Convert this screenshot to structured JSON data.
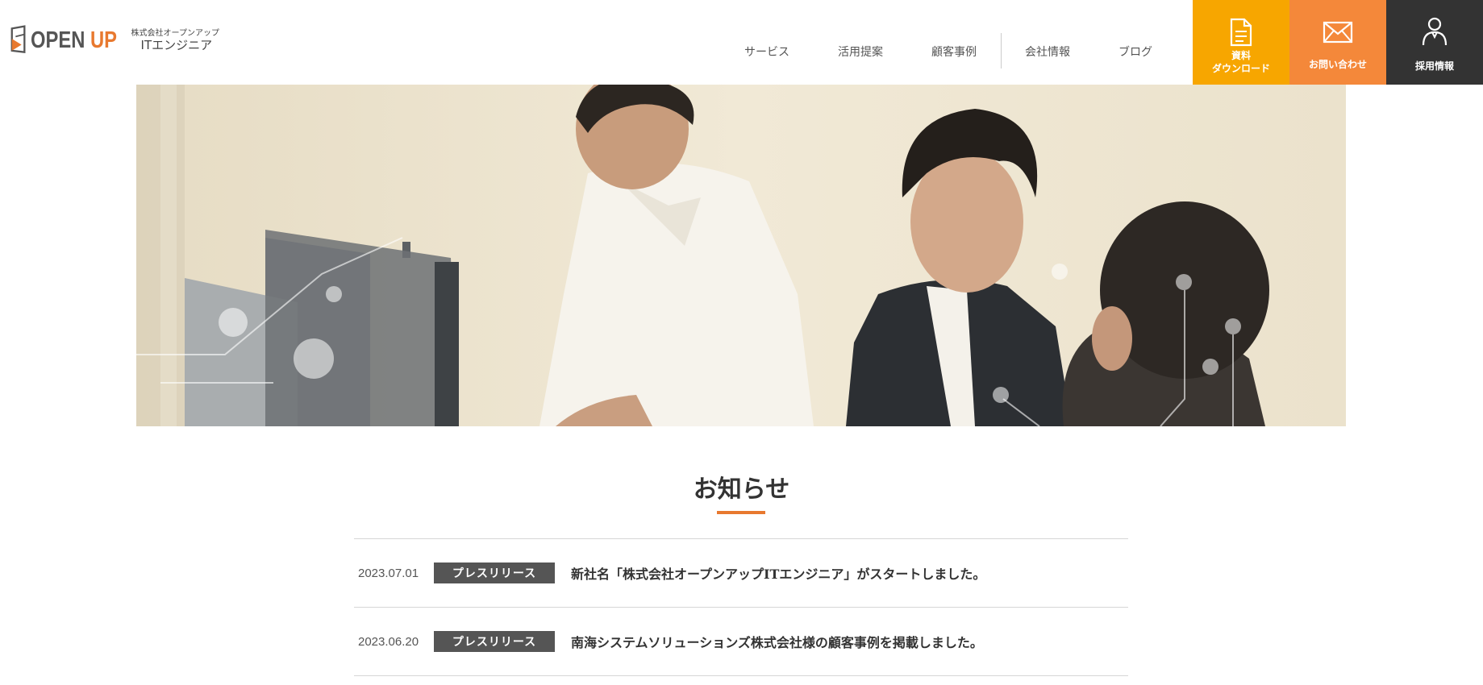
{
  "brand": {
    "logo_left": "OPEN ",
    "logo_right": "UP",
    "company_small": "株式会社オープンアップ",
    "company_large": "ITエンジニア",
    "accent_color": "#e8792f"
  },
  "nav": {
    "items": [
      {
        "label": "サービス"
      },
      {
        "label": "活用提案"
      },
      {
        "label": "顧客事例"
      },
      {
        "label": "会社情報"
      },
      {
        "label": "ブログ"
      }
    ]
  },
  "header_buttons": [
    {
      "label": "資料\nダウンロード",
      "icon": "document-icon",
      "color": "#f7a600"
    },
    {
      "label": "お問い合わせ",
      "icon": "mail-icon",
      "color": "#f4883a"
    },
    {
      "label": "採用情報",
      "icon": "person-icon",
      "color": "#333333"
    }
  ],
  "hero": {
    "image": "photo of three men looking at a computer monitor in an office"
  },
  "news": {
    "title": "お知らせ",
    "items": [
      {
        "date": "2023.07.01",
        "category": "プレスリリース",
        "title": "新社名「株式会社オープンアップITエンジニア」がスタートしました。"
      },
      {
        "date": "2023.06.20",
        "category": "プレスリリース",
        "title": "南海システムソリューションズ株式会社様の顧客事例を掲載しました。"
      }
    ]
  }
}
